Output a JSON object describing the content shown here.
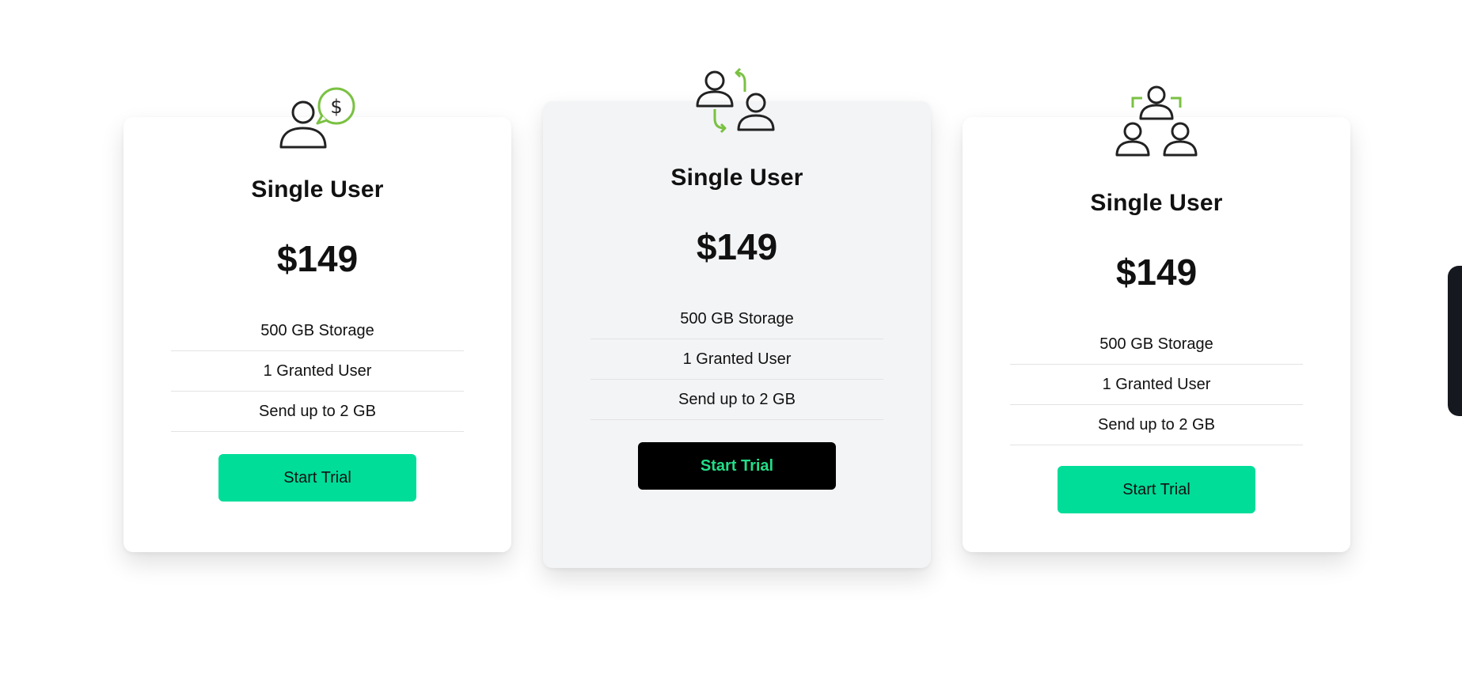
{
  "colors": {
    "accent_green": "#00dd99",
    "icon_green": "#7ac142",
    "icon_dark": "#222222",
    "featured_bg": "#f3f4f6"
  },
  "cards": [
    {
      "icon": "user-dollar-chat-icon",
      "title": "Single User",
      "price": "$149",
      "features": [
        "500 GB Storage",
        "1 Granted User",
        "Send up to 2 GB"
      ],
      "button_label": "Start Trial"
    },
    {
      "icon": "users-exchange-icon",
      "title": "Single User",
      "price": "$149",
      "features": [
        "500 GB Storage",
        "1 Granted User",
        "Send up to 2 GB"
      ],
      "button_label": "Start Trial"
    },
    {
      "icon": "team-group-icon",
      "title": "Single User",
      "price": "$149",
      "features": [
        "500 GB Storage",
        "1 Granted User",
        "Send up to 2 GB"
      ],
      "button_label": "Start Trial"
    }
  ],
  "side_tab": {
    "icon": "gear-icon"
  }
}
